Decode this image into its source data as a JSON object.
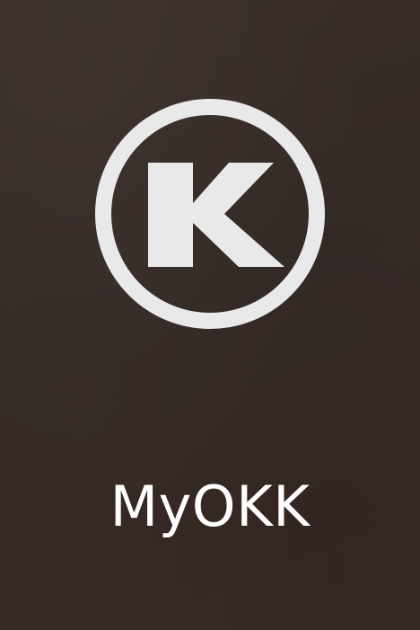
{
  "splash": {
    "app_name": "MyOKK",
    "logo_icon": "okk-k-circle-logo",
    "background_color": "#352a25",
    "logo_color": "#e9e9e9",
    "text_color": "#ffffff"
  }
}
